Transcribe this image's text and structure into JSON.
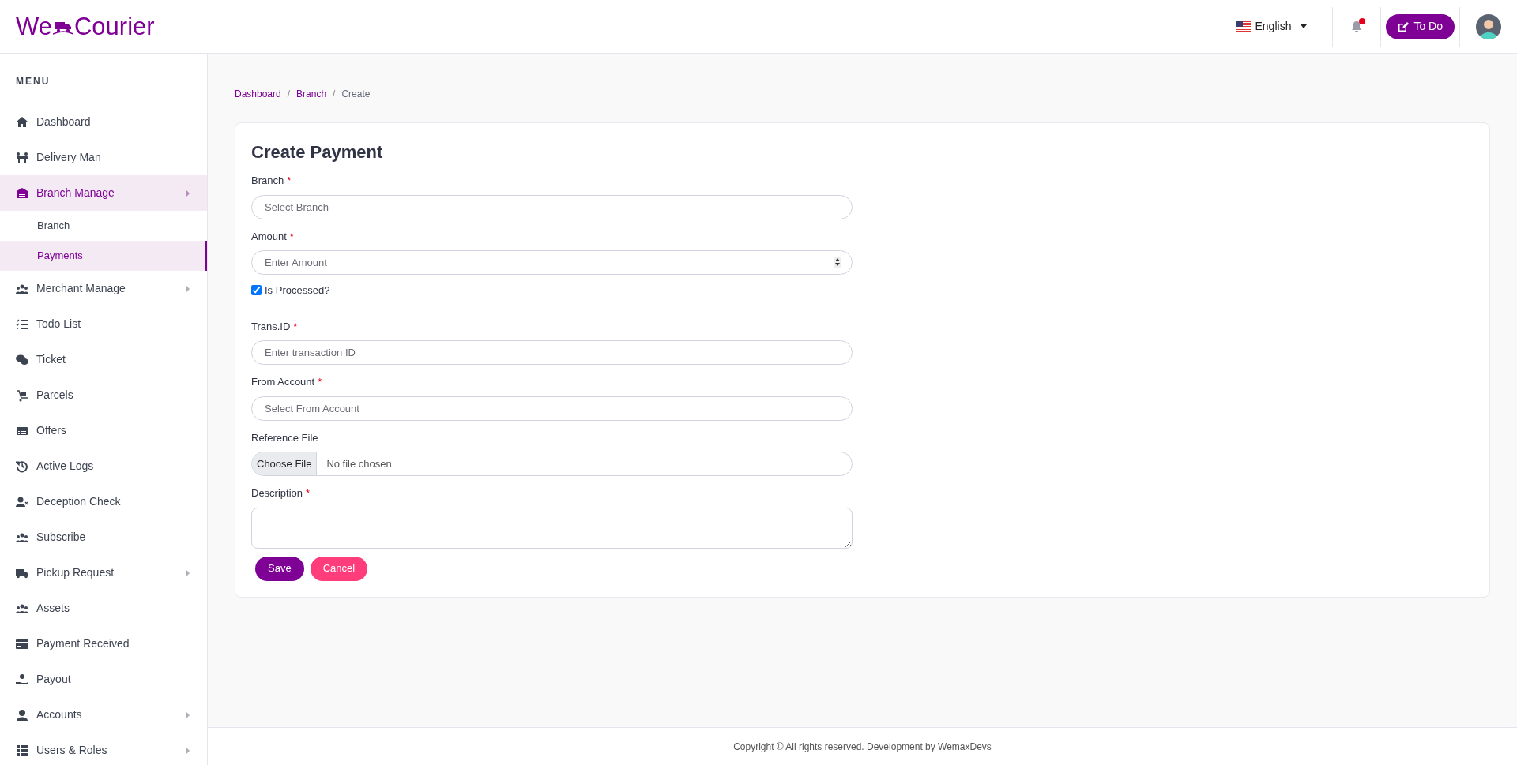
{
  "header": {
    "logo": {
      "left": "We",
      "right": "Courier"
    },
    "language": "English",
    "notification": {
      "unread": true
    },
    "todo_button": "To Do"
  },
  "sidebar": {
    "heading": "MENU",
    "items": [
      {
        "label": "Dashboard",
        "selected": false,
        "has_submenu": false
      },
      {
        "label": "Delivery Man",
        "selected": false,
        "has_submenu": false
      },
      {
        "label": "Branch Manage",
        "selected": true,
        "has_submenu": true,
        "expanded": true,
        "children": [
          {
            "label": "Branch",
            "selected": false
          },
          {
            "label": "Payments",
            "selected": true
          }
        ]
      },
      {
        "label": "Merchant Manage",
        "selected": false,
        "has_submenu": true,
        "expanded": false
      },
      {
        "label": "Todo List",
        "selected": false,
        "has_submenu": false
      },
      {
        "label": "Ticket",
        "selected": false,
        "has_submenu": false
      },
      {
        "label": "Parcels",
        "selected": false,
        "has_submenu": false
      },
      {
        "label": "Offers",
        "selected": false,
        "has_submenu": false
      },
      {
        "label": "Active Logs",
        "selected": false,
        "has_submenu": false
      },
      {
        "label": "Deception Check",
        "selected": false,
        "has_submenu": false
      },
      {
        "label": "Subscribe",
        "selected": false,
        "has_submenu": false
      },
      {
        "label": "Pickup Request",
        "selected": false,
        "has_submenu": true,
        "expanded": false
      },
      {
        "label": "Assets",
        "selected": false,
        "has_submenu": false
      },
      {
        "label": "Payment Received",
        "selected": false,
        "has_submenu": false
      },
      {
        "label": "Payout",
        "selected": false,
        "has_submenu": false
      },
      {
        "label": "Accounts",
        "selected": false,
        "has_submenu": true,
        "expanded": false
      },
      {
        "label": "Users & Roles",
        "selected": false,
        "has_submenu": true,
        "expanded": false
      }
    ]
  },
  "breadcrumb": [
    {
      "label": "Dashboard",
      "kind": "link"
    },
    {
      "label": "Branch",
      "kind": "link",
      "separator": "/"
    },
    {
      "label": "Create",
      "kind": "current",
      "separator": "/"
    }
  ],
  "form": {
    "title": "Create Payment",
    "fields": [
      {
        "kind": "select",
        "label": "Branch",
        "required_mark": "*",
        "placeholder": "Select Branch"
      },
      {
        "kind": "number",
        "label": "Amount",
        "required_mark": "*",
        "placeholder": "Enter Amount"
      },
      {
        "kind": "checkbox",
        "label": "Is Processed?",
        "checked": true
      },
      {
        "kind": "text",
        "label": "Trans.ID",
        "required_mark": "*",
        "placeholder": "Enter transaction ID"
      },
      {
        "kind": "select",
        "label": "From Account",
        "required_mark": "*",
        "placeholder": "Select From Account"
      },
      {
        "kind": "file",
        "label": "Reference File",
        "button": "Choose File",
        "status": "No file chosen"
      },
      {
        "kind": "textarea",
        "label": "Description",
        "required_mark": "*"
      }
    ],
    "buttons": [
      {
        "label": "Save",
        "kind": "primary"
      },
      {
        "label": "Cancel",
        "kind": "danger"
      }
    ]
  },
  "footer": "Copyright © All rights reserved. Development by WemaxDevs"
}
